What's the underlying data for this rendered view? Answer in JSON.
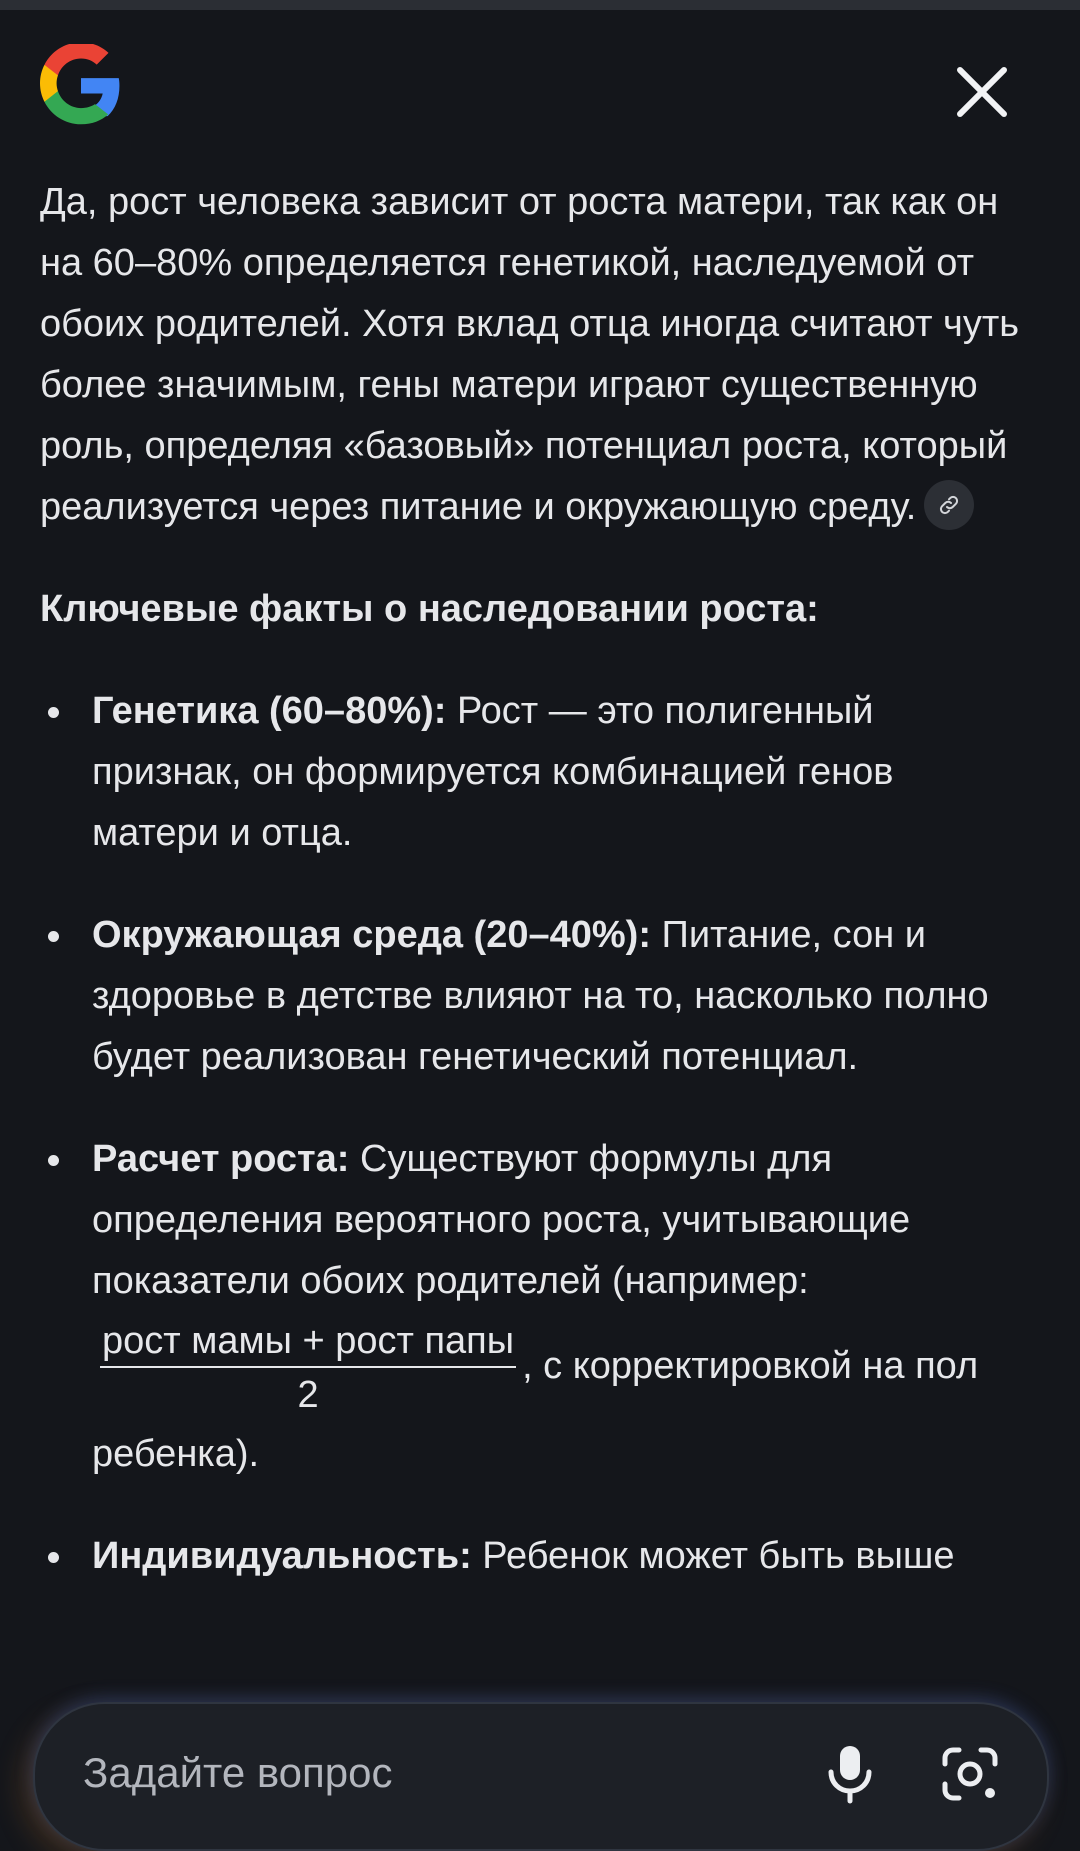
{
  "header": {
    "logo_icon": "google-g-logo",
    "close_icon": "close-icon"
  },
  "answer": {
    "intro": "Да, рост человека зависит от роста матери, так как он на 60–80% определяется генетикой, наследуемой от обоих родителей. Хотя вклад отца иногда считают чуть более значимым, гены матери играют существенную роль, определяя «базовый» потенциал роста, который реализуется через питание и окружающую среду.",
    "source_icon": "link-icon",
    "heading": "Ключевые факты о наследовании роста:",
    "facts": [
      {
        "title": "Генетика (60–80%):",
        "text": " Рост — это полигенный признак, он формируется комбинацией генов матери и отца."
      },
      {
        "title": "Окружающая среда (20–40%):",
        "text": " Питание, сон и здоровье в детстве влияют на то, насколько полно будет реализован генетический потенциал."
      },
      {
        "title": "Расчет роста:",
        "text_before": " Существуют формулы для определения вероятного роста, учитывающие показатели обоих родителей (например: ",
        "formula_numerator": "рост мамы + рост папы",
        "formula_denominator": "2",
        "text_after": ", с корректировкой на пол ребенка)."
      },
      {
        "title": "Индивидуальность:",
        "text": " Ребенок может быть выше"
      }
    ]
  },
  "ask": {
    "placeholder": "Задайте вопрос",
    "mic_icon": "microphone-icon",
    "lens_icon": "camera-search-icon"
  },
  "colors": {
    "background": "#14161b",
    "text": "#e6e7ea",
    "muted_text": "#b3b6bd",
    "google_blue": "#4285f4",
    "google_red": "#ea4335",
    "google_yellow": "#fbbc05",
    "google_green": "#34a853"
  }
}
